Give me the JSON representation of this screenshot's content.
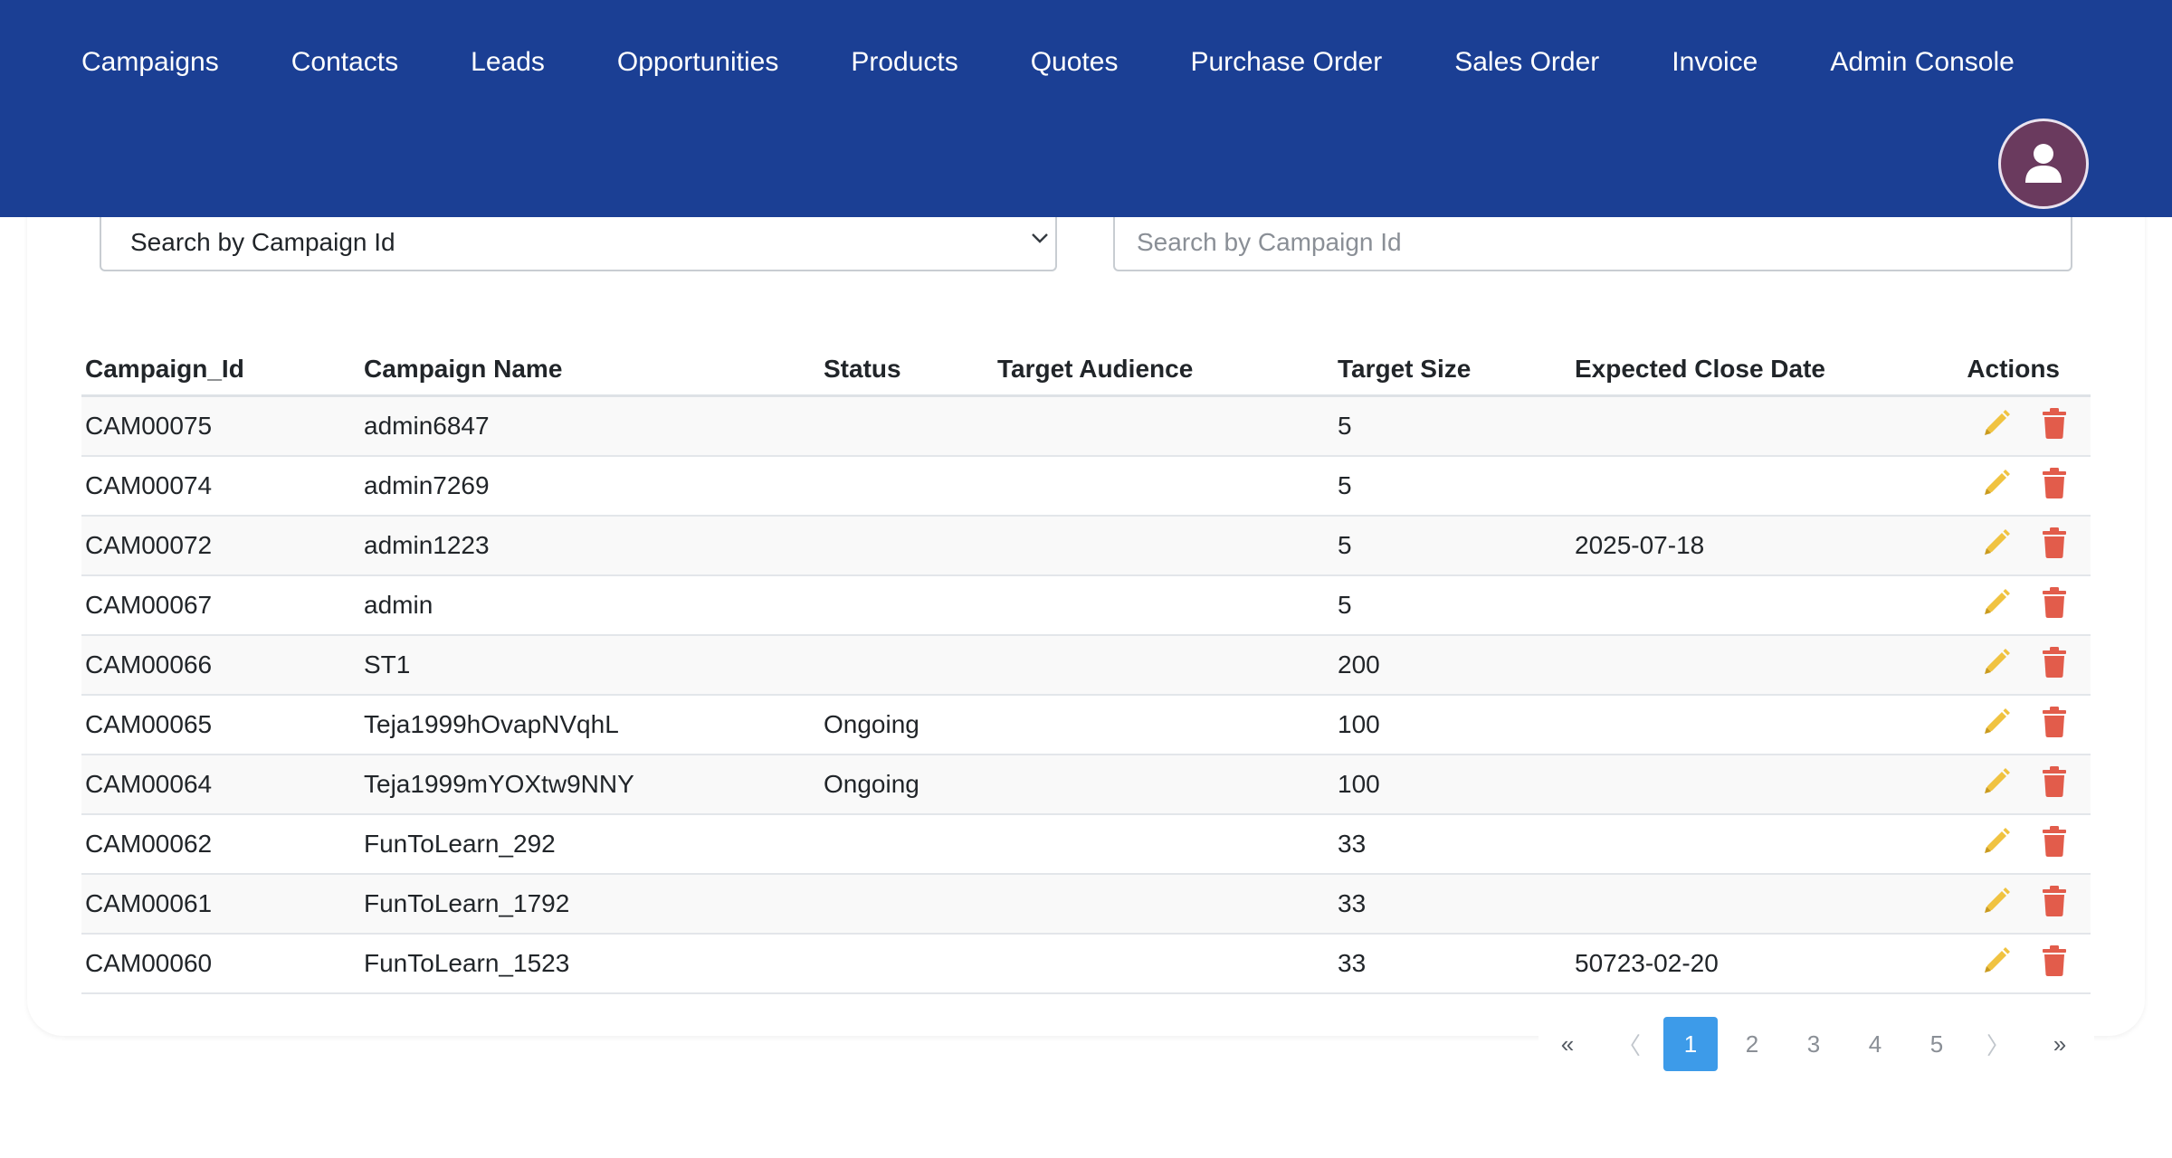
{
  "nav": {
    "links": [
      "Campaigns",
      "Contacts",
      "Leads",
      "Opportunities",
      "Products",
      "Quotes",
      "Purchase Order",
      "Sales Order",
      "Invoice",
      "Admin Console"
    ],
    "avatar_icon": "user-icon"
  },
  "filters": {
    "select_value": "Search by Campaign Id",
    "search_placeholder": "Search by Campaign Id"
  },
  "table": {
    "headers": [
      "Campaign_Id",
      "Campaign Name",
      "Status",
      "Target Audience",
      "Target Size",
      "Expected Close Date",
      "Actions"
    ],
    "rows": [
      [
        "CAM00075",
        "admin6847",
        "",
        "",
        "5",
        ""
      ],
      [
        "CAM00074",
        "admin7269",
        "",
        "",
        "5",
        ""
      ],
      [
        "CAM00072",
        "admin1223",
        "",
        "",
        "5",
        "2025-07-18"
      ],
      [
        "CAM00067",
        "admin",
        "",
        "",
        "5",
        ""
      ],
      [
        "CAM00066",
        "ST1",
        "",
        "",
        "200",
        ""
      ],
      [
        "CAM00065",
        "Teja1999hOvapNVqhL",
        "Ongoing",
        "",
        "100",
        ""
      ],
      [
        "CAM00064",
        "Teja1999mYOXtw9NNY",
        "Ongoing",
        "",
        "100",
        ""
      ],
      [
        "CAM00062",
        "FunToLearn_292",
        "",
        "",
        "33",
        ""
      ],
      [
        "CAM00061",
        "FunToLearn_1792",
        "",
        "",
        "33",
        ""
      ],
      [
        "CAM00060",
        "FunToLearn_1523",
        "",
        "",
        "33",
        "50723-02-20"
      ]
    ],
    "action_icons": [
      "edit-icon",
      "delete-icon"
    ]
  },
  "pagination": {
    "first": "«",
    "prev": "〈",
    "pages": [
      "1",
      "2",
      "3",
      "4",
      "5"
    ],
    "active_page": "1",
    "next": "〉",
    "last": "»"
  },
  "colors": {
    "navbar": "#1b3f94",
    "edit": "#f0c341",
    "delete": "#e25c4b",
    "active_page": "#3d9be9"
  }
}
